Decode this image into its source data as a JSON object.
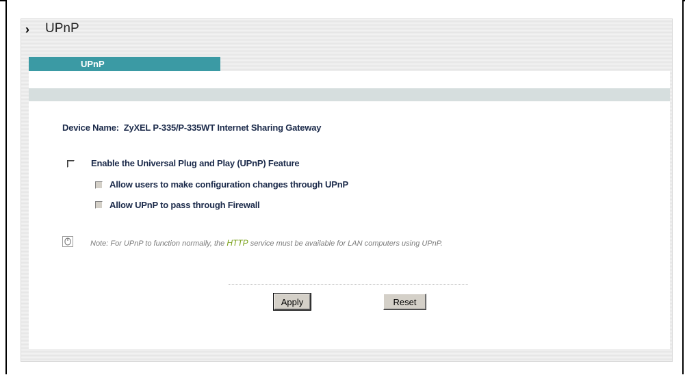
{
  "page": {
    "title": "UPnP",
    "title_marker": "›"
  },
  "tab": {
    "label": "UPnP"
  },
  "device": {
    "label": "Device Name:",
    "value": "ZyXEL P-335/P-335WT Internet Sharing Gateway"
  },
  "options": {
    "enable_upnp": {
      "label": "Enable the Universal Plug and Play (UPnP) Feature",
      "checked": false,
      "disabled": false
    },
    "allow_config": {
      "label": "Allow users to make configuration changes through UPnP",
      "checked": false,
      "disabled": true
    },
    "allow_firewall": {
      "label": "Allow UPnP to pass through Firewall",
      "checked": false,
      "disabled": true
    }
  },
  "note": {
    "prefix": "Note: For UPnP to function normally, the ",
    "highlight": "HTTP",
    "suffix": " service must be available for LAN computers using UPnP.",
    "icon": "note-icon"
  },
  "buttons": {
    "apply": "Apply",
    "reset": "Reset"
  },
  "colors": {
    "tab": "#3b9aa4",
    "highlight": "#7aa11a",
    "label_text": "#1b2a4a"
  }
}
